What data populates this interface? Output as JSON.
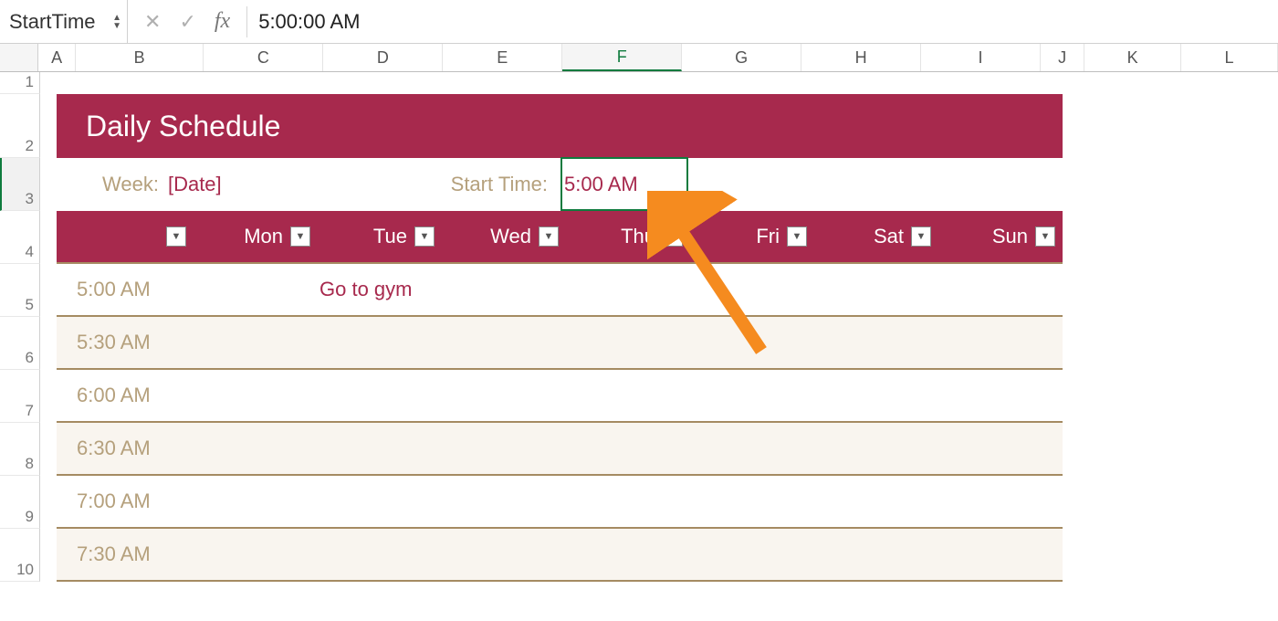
{
  "formula_bar": {
    "namebox": "StartTime",
    "formula": "5:00:00 AM",
    "fx_label": "fx",
    "cancel_glyph": "✕",
    "confirm_glyph": "✓"
  },
  "columns": [
    "A",
    "B",
    "C",
    "D",
    "E",
    "F",
    "G",
    "H",
    "I",
    "J",
    "K",
    "L"
  ],
  "active_column": "F",
  "row_numbers": [
    1,
    2,
    3,
    4,
    5,
    6,
    7,
    8,
    9,
    10
  ],
  "active_row": 3,
  "title": "Daily Schedule",
  "week": {
    "label": "Week:",
    "value": "[Date]"
  },
  "start": {
    "label": "Start Time:",
    "value": "5:00 AM"
  },
  "days": [
    "Mon",
    "Tue",
    "Wed",
    "Thu",
    "Fri",
    "Sat",
    "Sun"
  ],
  "filter_glyph": "▼",
  "times": [
    "5:00 AM",
    "5:30 AM",
    "6:00 AM",
    "6:30 AM",
    "7:00 AM",
    "7:30 AM"
  ],
  "entries": {
    "0": {
      "Tue": "Go to gym"
    }
  },
  "row_heights": {
    "r1": 24,
    "r2": 70,
    "r3": 58,
    "rday": 58,
    "rs": 58
  },
  "colors": {
    "brand": "#a7294d",
    "tan": "#b5a07c",
    "rule": "#a58b62",
    "green": "#0f7b3e",
    "orange": "#f58b1f"
  }
}
